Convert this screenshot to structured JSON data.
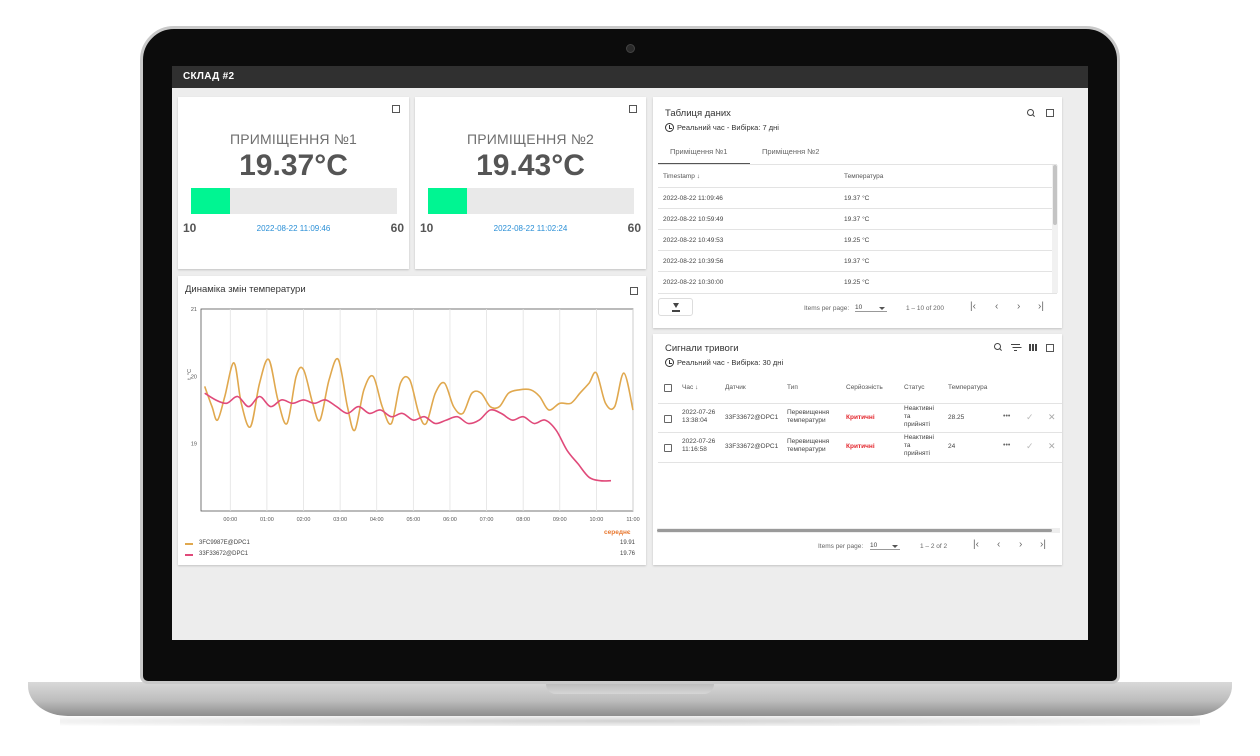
{
  "app": {
    "title": "СКЛАД #2"
  },
  "gauges": [
    {
      "title": "ПРИМІЩЕННЯ №1",
      "value": "19.37°C",
      "min": "10",
      "max": "60",
      "level_pct": 19,
      "timestamp": "2022-08-22 11:09:46"
    },
    {
      "title": "ПРИМІЩЕННЯ №2",
      "value": "19.43°C",
      "min": "10",
      "max": "60",
      "level_pct": 19,
      "timestamp": "2022-08-22 11:02:24"
    }
  ],
  "data_table": {
    "title": "Таблиця даних",
    "subtitle": "Реальний час - Вибірка: 7 дні",
    "tabs": [
      "Приміщення №1",
      "Приміщення №2"
    ],
    "columns": [
      "Timestamp",
      "Температура"
    ],
    "rows": [
      [
        "2022-08-22 11:09:46",
        "19.37 °C"
      ],
      [
        "2022-08-22 10:59:49",
        "19.37 °C"
      ],
      [
        "2022-08-22 10:49:53",
        "19.25 °C"
      ],
      [
        "2022-08-22 10:39:56",
        "19.37 °C"
      ],
      [
        "2022-08-22 10:30:00",
        "19.25 °C"
      ]
    ],
    "items_per_page_label": "Items per page:",
    "items_per_page": "10",
    "range": "1 – 10 of 200"
  },
  "chart": {
    "title": "Динаміка змін температури",
    "avg_header": "середнє",
    "legend": [
      {
        "name": "3FC9987E@DPC1",
        "avg": "19.91",
        "color": "#e0a84e"
      },
      {
        "name": "33F33672@DPC1",
        "avg": "19.76",
        "color": "#e04a7a"
      }
    ]
  },
  "chart_data": {
    "type": "line",
    "ylabel": "t, °C",
    "ylim": [
      18,
      21
    ],
    "yticks": [
      "21",
      "20",
      "19"
    ],
    "x": [
      "00:00",
      "01:00",
      "02:00",
      "03:00",
      "04:00",
      "05:00",
      "06:00",
      "07:00",
      "08:00",
      "09:00",
      "10:00",
      "11:00"
    ],
    "series": [
      {
        "name": "3FC9987E@DPC1",
        "color": "#e0a84e",
        "points": [
          [
            -0.7,
            19.85
          ],
          [
            -0.5,
            19.55
          ],
          [
            -0.35,
            19.35
          ],
          [
            -0.15,
            19.7
          ],
          [
            0.1,
            20.2
          ],
          [
            0.3,
            19.6
          ],
          [
            0.55,
            19.25
          ],
          [
            0.8,
            19.9
          ],
          [
            1.05,
            20.25
          ],
          [
            1.3,
            19.65
          ],
          [
            1.55,
            19.3
          ],
          [
            1.8,
            20.0
          ],
          [
            2.0,
            20.1
          ],
          [
            2.25,
            19.6
          ],
          [
            2.45,
            19.35
          ],
          [
            2.7,
            19.95
          ],
          [
            2.95,
            20.25
          ],
          [
            3.2,
            19.55
          ],
          [
            3.4,
            19.2
          ],
          [
            3.65,
            19.8
          ],
          [
            3.9,
            20.0
          ],
          [
            4.15,
            19.55
          ],
          [
            4.4,
            19.3
          ],
          [
            4.65,
            19.9
          ],
          [
            4.9,
            19.95
          ],
          [
            5.15,
            19.45
          ],
          [
            5.35,
            19.3
          ],
          [
            5.6,
            19.75
          ],
          [
            5.85,
            19.9
          ],
          [
            6.1,
            19.55
          ],
          [
            6.35,
            19.45
          ],
          [
            6.6,
            19.75
          ],
          [
            6.85,
            19.75
          ],
          [
            7.1,
            19.55
          ],
          [
            7.35,
            19.55
          ],
          [
            7.6,
            19.75
          ],
          [
            7.9,
            19.8
          ],
          [
            8.2,
            19.8
          ],
          [
            8.45,
            19.7
          ],
          [
            8.7,
            19.5
          ],
          [
            9.0,
            19.6
          ],
          [
            9.3,
            19.6
          ],
          [
            9.55,
            19.75
          ],
          [
            9.8,
            19.9
          ],
          [
            10.0,
            20.05
          ],
          [
            10.25,
            19.6
          ],
          [
            10.5,
            19.55
          ],
          [
            10.75,
            20.05
          ],
          [
            11.0,
            19.5
          ]
        ]
      },
      {
        "name": "33F33672@DPC1",
        "color": "#e04a7a",
        "points": [
          [
            -0.7,
            19.75
          ],
          [
            -0.4,
            19.65
          ],
          [
            -0.1,
            19.6
          ],
          [
            0.2,
            19.7
          ],
          [
            0.5,
            19.55
          ],
          [
            0.8,
            19.7
          ],
          [
            1.1,
            19.55
          ],
          [
            1.4,
            19.65
          ],
          [
            1.7,
            19.6
          ],
          [
            2.0,
            19.65
          ],
          [
            2.3,
            19.6
          ],
          [
            2.6,
            19.65
          ],
          [
            2.9,
            19.55
          ],
          [
            3.2,
            19.45
          ],
          [
            3.5,
            19.55
          ],
          [
            3.8,
            19.45
          ],
          [
            4.1,
            19.5
          ],
          [
            4.4,
            19.4
          ],
          [
            4.7,
            19.45
          ],
          [
            5.0,
            19.35
          ],
          [
            5.3,
            19.4
          ],
          [
            5.6,
            19.3
          ],
          [
            5.9,
            19.35
          ],
          [
            6.2,
            19.4
          ],
          [
            6.5,
            19.3
          ],
          [
            6.8,
            19.35
          ],
          [
            7.1,
            19.5
          ],
          [
            7.4,
            19.45
          ],
          [
            7.7,
            19.35
          ],
          [
            8.0,
            19.4
          ],
          [
            8.3,
            19.3
          ],
          [
            8.6,
            19.35
          ],
          [
            8.9,
            19.2
          ],
          [
            9.2,
            18.9
          ],
          [
            9.5,
            18.7
          ],
          [
            9.8,
            18.5
          ],
          [
            10.1,
            18.45
          ],
          [
            10.4,
            18.45
          ]
        ]
      }
    ]
  },
  "alarms": {
    "title": "Сигнали тривоги",
    "subtitle": "Реальний час - Вибірка: 30 дні",
    "columns": [
      "Час",
      "Датчик",
      "Тип",
      "Серйозність",
      "Статус",
      "Температура"
    ],
    "rows": [
      {
        "time": [
          "2022-07-26",
          "13:38:04"
        ],
        "sensor": "33F33672@DPC1",
        "type": [
          "Перевищення",
          "температури"
        ],
        "severity": "Критичні",
        "status": [
          "Неактивні",
          "та",
          "прийняті"
        ],
        "temperature": "28.25",
        "more": "•••",
        "ack": "✓",
        "clear": "✕"
      },
      {
        "time": [
          "2022-07-26",
          "11:16:58"
        ],
        "sensor": "33F33672@DPC1",
        "type": [
          "Перевищення",
          "температури"
        ],
        "severity": "Критичні",
        "status": [
          "Неактивні",
          "та",
          "прийняті"
        ],
        "temperature": "24",
        "more": "•••",
        "ack": "✓",
        "clear": "✕"
      }
    ],
    "items_per_page_label": "Items per page:",
    "items_per_page": "10",
    "range": "1 – 2 of 2"
  },
  "pager_icons": {
    "first": "|‹",
    "prev": "‹",
    "next": "›",
    "last": "›|"
  }
}
